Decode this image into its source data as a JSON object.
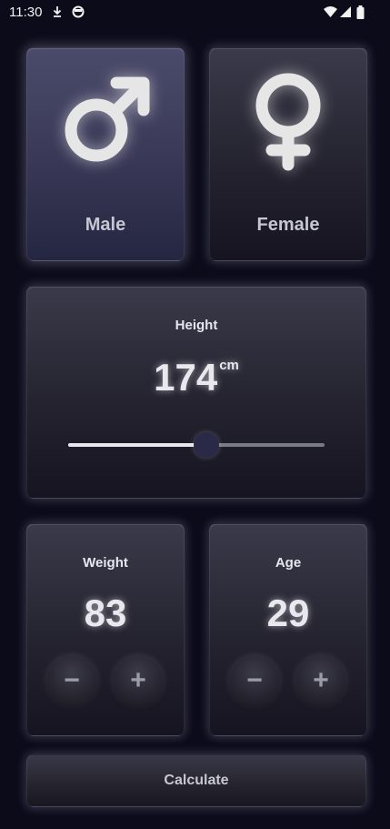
{
  "status_bar": {
    "time": "11:30",
    "icons": [
      "download-icon",
      "vpn-icon",
      "wifi-icon",
      "signal-icon",
      "battery-icon"
    ]
  },
  "gender": {
    "male_label": "Male",
    "female_label": "Female",
    "selected": "Male"
  },
  "height": {
    "title": "Height",
    "value": "174",
    "unit": "cm",
    "slider_fraction": 0.54
  },
  "weight": {
    "title": "Weight",
    "value": "83",
    "minus": "−",
    "plus": "+"
  },
  "age": {
    "title": "Age",
    "value": "29",
    "minus": "−",
    "plus": "+"
  },
  "calculate_label": "Calculate",
  "colors": {
    "background": "#0b0b1a",
    "selected_card": "#3a3a58",
    "card": "#24232f",
    "slider_thumb": "#2a2a48"
  }
}
